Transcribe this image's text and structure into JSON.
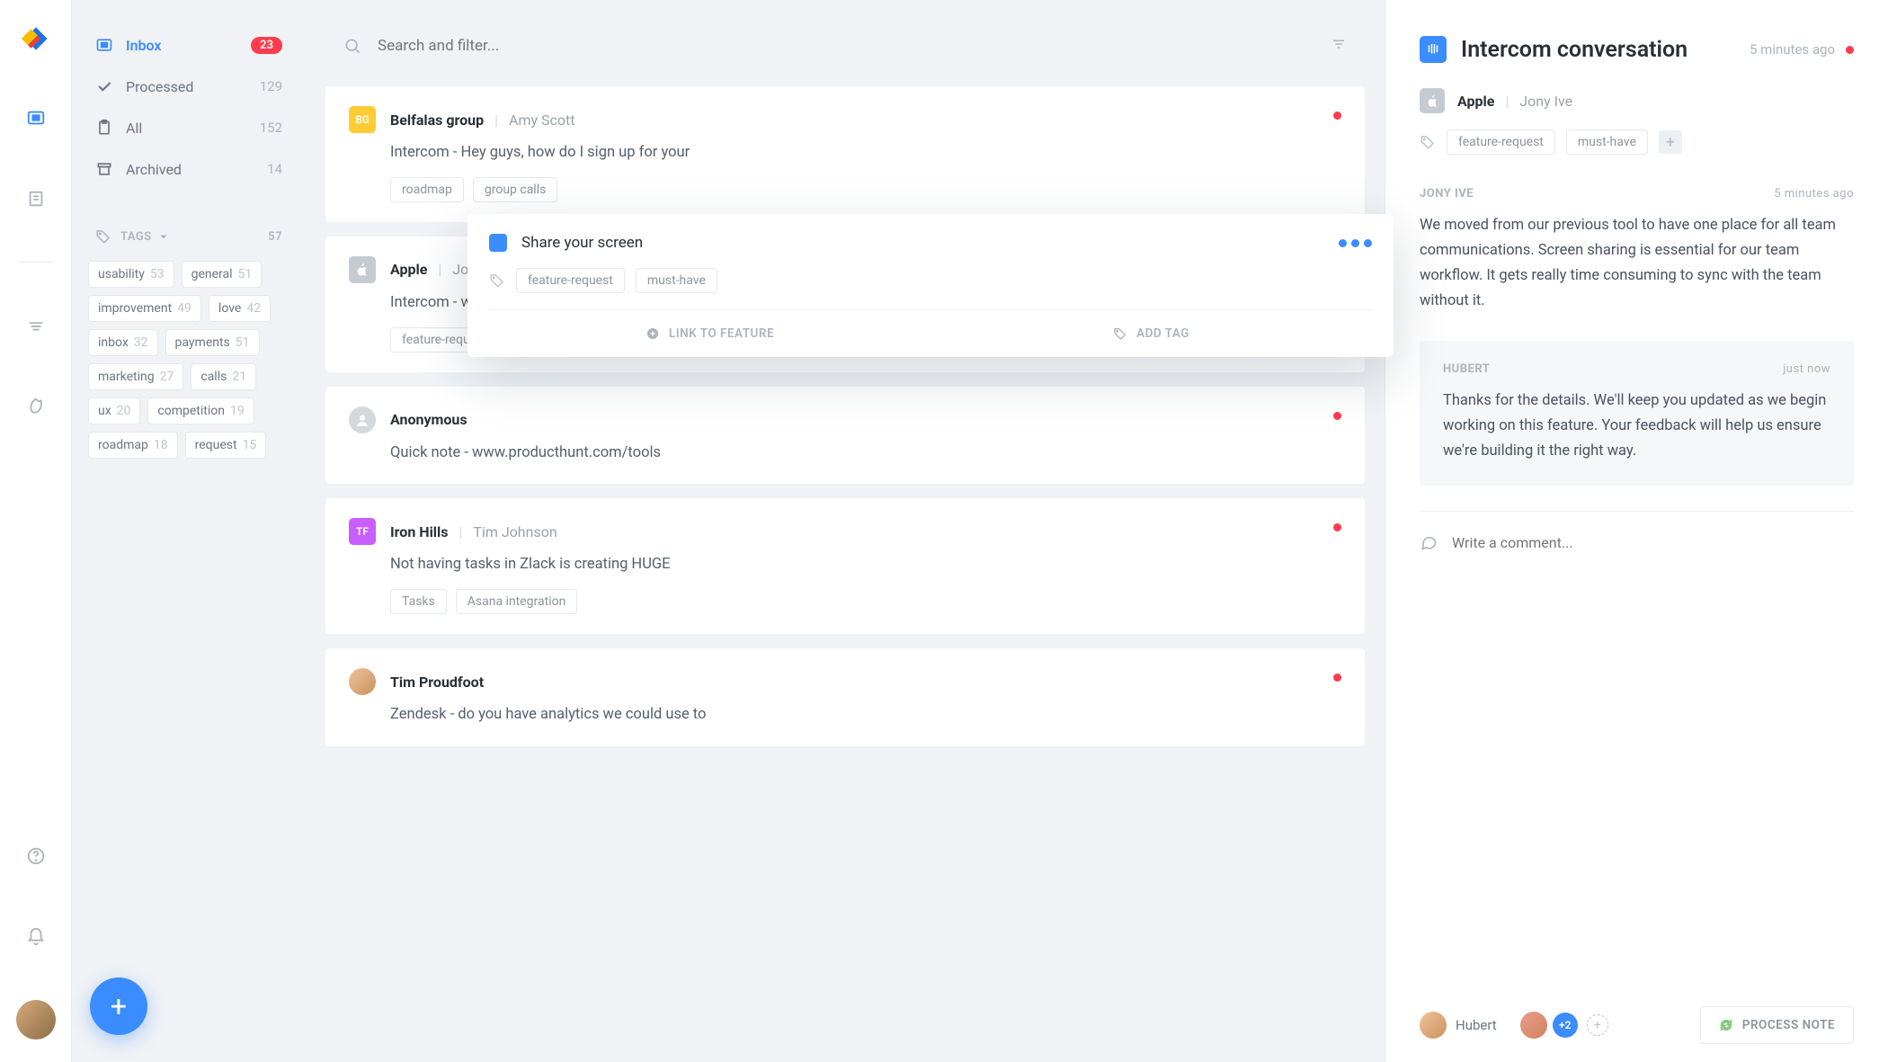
{
  "nav": {
    "items": [
      {
        "label": "Inbox",
        "count": "23",
        "active": true
      },
      {
        "label": "Processed",
        "count": "129"
      },
      {
        "label": "All",
        "count": "152"
      },
      {
        "label": "Archived",
        "count": "14"
      }
    ],
    "tags_header": "TAGS",
    "tags_count": "57",
    "tags": [
      {
        "label": "usability",
        "count": "53"
      },
      {
        "label": "general",
        "count": "51"
      },
      {
        "label": "improvement",
        "count": "49"
      },
      {
        "label": "love",
        "count": "42"
      },
      {
        "label": "inbox",
        "count": "32"
      },
      {
        "label": "payments",
        "count": "51"
      },
      {
        "label": "marketing",
        "count": "27"
      },
      {
        "label": "calls",
        "count": "21"
      },
      {
        "label": "ux",
        "count": "20"
      },
      {
        "label": "competition",
        "count": "19"
      },
      {
        "label": "roadmap",
        "count": "18"
      },
      {
        "label": "request",
        "count": "15"
      }
    ]
  },
  "search": {
    "placeholder": "Search and filter..."
  },
  "cards": [
    {
      "avatar": "BG",
      "company": "Belfalas group",
      "person": "Amy Scott",
      "body": "Intercom - Hey guys, how do I sign up for your",
      "tags": [
        "roadmap",
        "group calls"
      ],
      "unread": true
    },
    {
      "avatar": "apple",
      "company": "Apple",
      "person": "Jon",
      "body": "Intercom - we",
      "tags": [
        "feature-requ"
      ],
      "unread": false
    },
    {
      "avatar": "anon",
      "company": "Anonymous",
      "person": "",
      "body": "Quick note - www.producthunt.com/tools",
      "tags": [],
      "unread": true
    },
    {
      "avatar": "TF",
      "company": "Iron Hills",
      "person": "Tim Johnson",
      "body": "Not having tasks in Zlack is creating HUGE",
      "tags": [
        "Tasks",
        "Asana integration"
      ],
      "unread": true
    },
    {
      "avatar": "photo",
      "company": "Tim Proudfoot",
      "person": "",
      "body": "Zendesk - do you have analytics we could use to",
      "tags": [],
      "unread": true
    }
  ],
  "popover": {
    "title": "Share your screen",
    "tags": [
      "feature-request",
      "must-have"
    ],
    "link_label": "LINK TO FEATURE",
    "add_tag_label": "ADD TAG"
  },
  "detail": {
    "title": "Intercom conversation",
    "time": "5 minutes ago",
    "company": "Apple",
    "person": "Jony Ive",
    "tags": [
      "feature-request",
      "must-have"
    ],
    "msg1_author": "JONY IVE",
    "msg1_time": "5 minutes ago",
    "msg1_body": "We moved from our previous tool to have one place for all team communications. Screen sharing is essential for our team workflow. It gets really time consuming to sync with the team without it.",
    "msg2_author": "HUBERT",
    "msg2_time": "just now",
    "msg2_body": "Thanks for the details. We'll keep you updated as we begin working on this feature. Your feedback will help us ensure we're building it the right way.",
    "comment_placeholder": "Write a comment...",
    "footer_name": "Hubert",
    "more_count": "+2",
    "process_label": "PROCESS NOTE"
  }
}
